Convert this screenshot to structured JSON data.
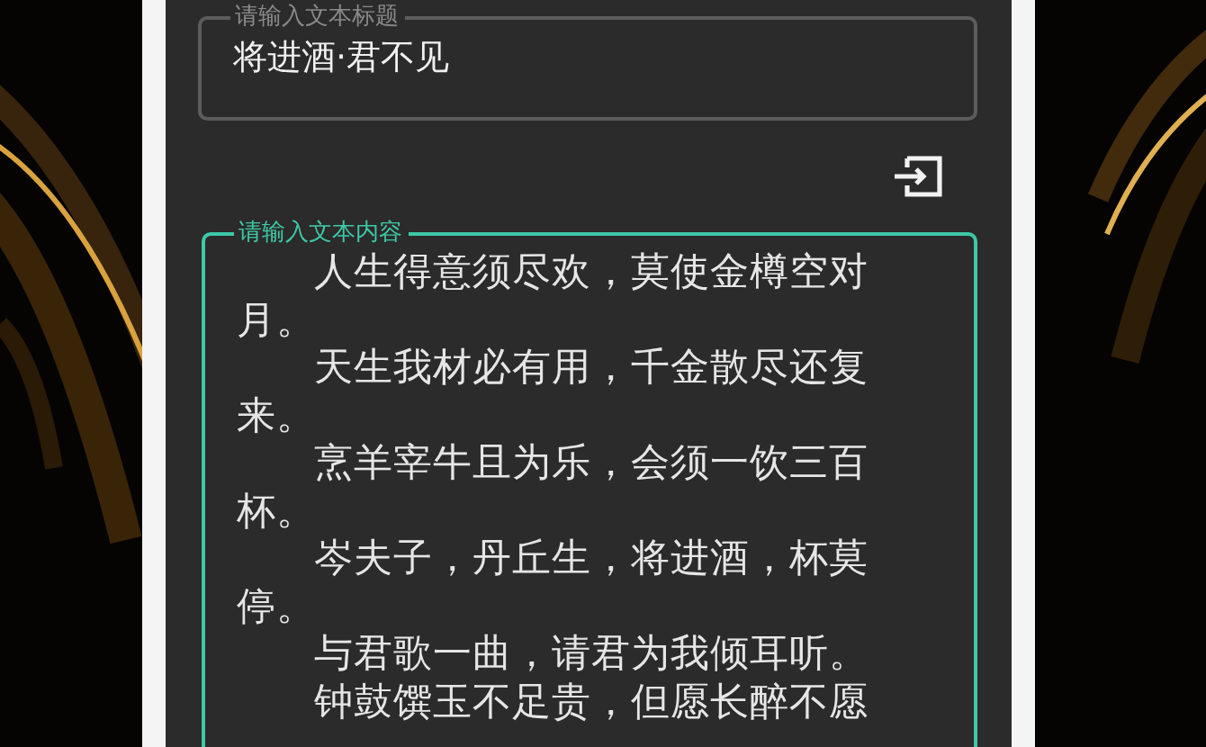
{
  "title_field": {
    "label": "请输入文本标题",
    "value": "将进酒·君不见",
    "focused": false
  },
  "content_field": {
    "label": "请输入文本内容",
    "focused": true,
    "paragraphs": [
      "人生得意须尽欢，莫使金樽空对月。",
      "天生我材必有用，千金散尽还复来。",
      "烹羊宰牛且为乐，会须一饮三百杯。",
      "岑夫子，丹丘生，将进酒，杯莫停。",
      "与君歌一曲，请君为我倾耳听。",
      "钟鼓馔玉不足贵，但愿长醉不愿"
    ]
  }
}
